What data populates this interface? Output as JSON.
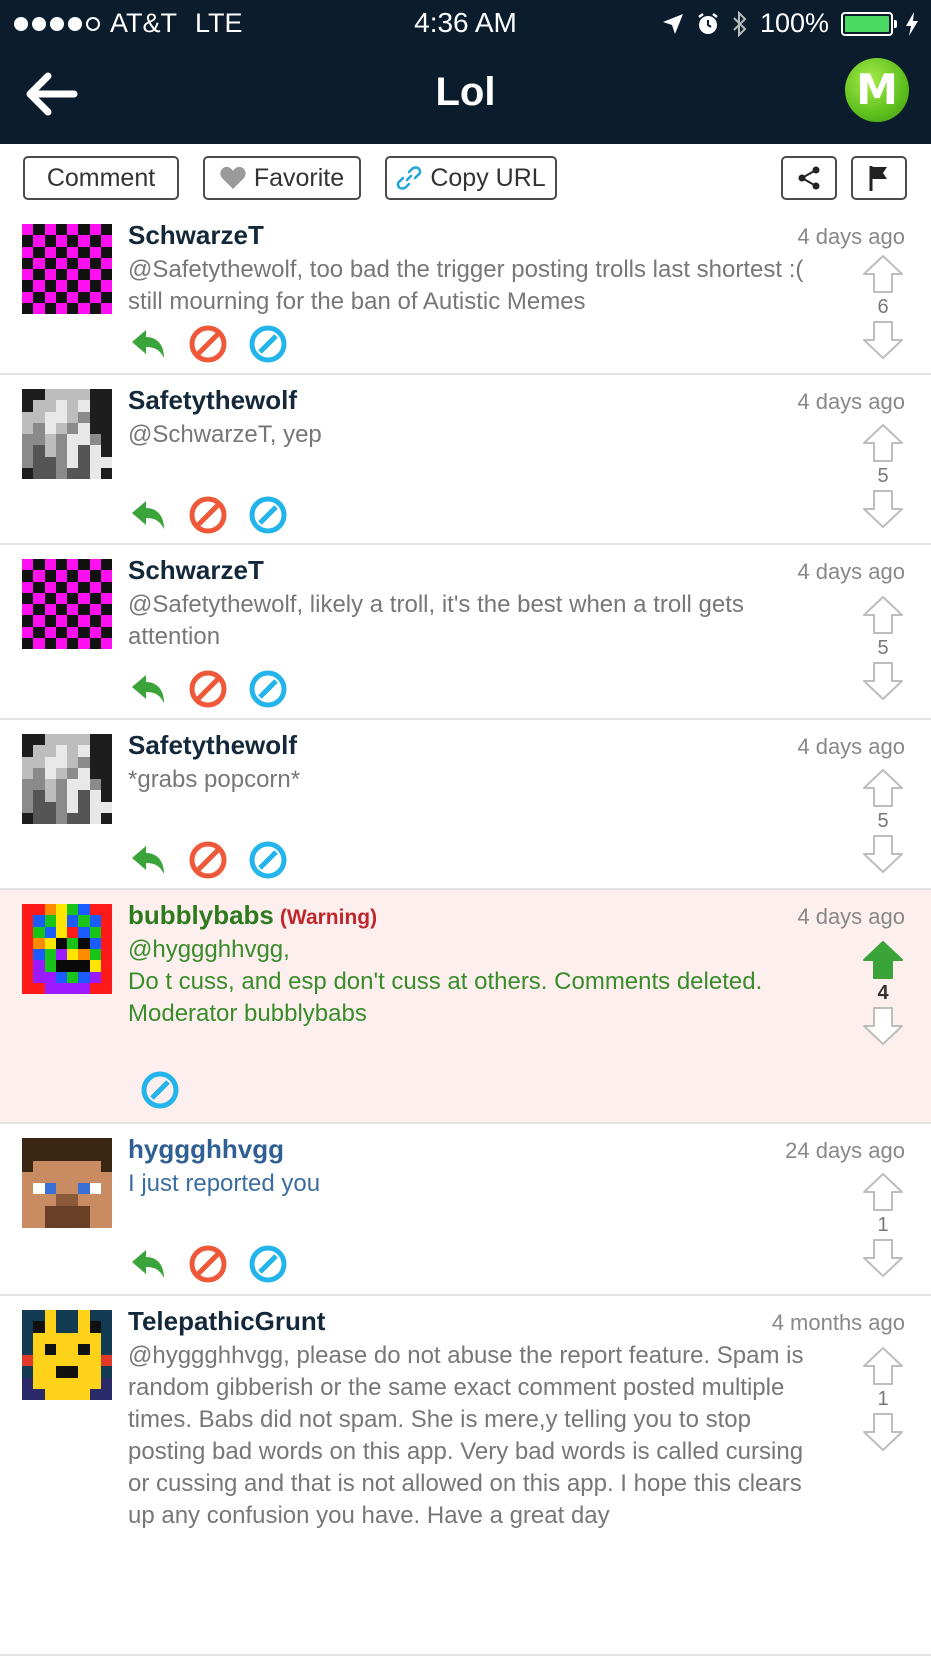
{
  "status_bar": {
    "carrier": "AT&T",
    "network": "LTE",
    "time": "4:36 AM",
    "battery": "100%",
    "battery_level": 1.0
  },
  "nav": {
    "title": "Lol",
    "logo_letter": "M"
  },
  "toolbar": {
    "comment_label": "Comment",
    "favorite_label": "Favorite",
    "copy_url_label": "Copy URL"
  },
  "comments": [
    {
      "user": "SchwarzeT",
      "time": "4 days ago",
      "text": "@Safetythewolf, too bad the trigger posting trolls last shortest :( still mourning for the ban of Autistic Memes",
      "votes": "6",
      "avatar": "checker-magenta"
    },
    {
      "user": "Safetythewolf",
      "time": "4 days ago",
      "text": "@SchwarzeT, yep",
      "votes": "5",
      "avatar": "gray-wolf"
    },
    {
      "user": "SchwarzeT",
      "time": "4 days ago",
      "text": "@Safetythewolf, likely a troll, it's the best when a troll gets attention",
      "votes": "5",
      "avatar": "checker-magenta"
    },
    {
      "user": "Safetythewolf",
      "time": "4 days ago",
      "text": "*grabs popcorn*",
      "votes": "5",
      "avatar": "gray-wolf"
    },
    {
      "user": "bubblybabs",
      "warning": "(Warning)",
      "time": "4 days ago",
      "text": "@hyggghhvgg,\nDo t cuss, and esp don't cuss at others. Comments deleted.\nModerator bubblybabs",
      "votes": "4",
      "avatar": "rainbow"
    },
    {
      "user": "hyggghhvgg",
      "time": "24 days ago",
      "text": "I just reported you",
      "votes": "1",
      "avatar": "steve"
    },
    {
      "user": "TelepathicGrunt",
      "time": "4 months ago",
      "text": "@hyggghhvgg, please do not abuse the report feature. Spam is random gibberish or the same exact comment posted multiple times. Babs did not spam. She is mere,y telling you to stop posting bad words on this app. Very bad words is called cursing or cussing and that is not allowed on this app. I hope this clears up any confusion you have. Have a great day",
      "votes": "1",
      "avatar": "pikachu"
    }
  ],
  "colors": {
    "header_bg": "#0b1c2c",
    "reply_green": "#3aa33a",
    "block_red": "#f0583a",
    "report_blue": "#22b4ea",
    "moderator_bg": "#fcefee",
    "moderator_text": "#3a8c2a",
    "warning_red": "#c0262d",
    "upvote_green": "#3aa33a"
  }
}
